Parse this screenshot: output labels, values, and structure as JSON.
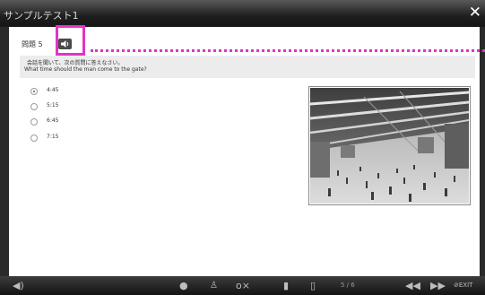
{
  "window": {
    "title": "サンプルテスト1"
  },
  "question": {
    "label": "問題 5",
    "instruction_jp": "会話を聞いて、次の質問に答えなさい。",
    "instruction_en": "What time should the man come to the gate?",
    "options": [
      {
        "text": "4:45",
        "selected": true
      },
      {
        "text": "5:15",
        "selected": false
      },
      {
        "text": "6:45",
        "selected": false
      },
      {
        "text": "7:15",
        "selected": false
      }
    ]
  },
  "footer": {
    "page_indicator": "5 / 6",
    "exit_label": "EXIT"
  },
  "colors": {
    "highlight": "#e233c6",
    "titlebar": "#1e1e1e"
  },
  "icons": [
    "speaker-icon",
    "close-icon",
    "volume-icon",
    "comment-icon",
    "person-icon",
    "key-icon",
    "document-icon",
    "document-list-icon",
    "rewind-icon",
    "fast-forward-icon",
    "exit-icon"
  ]
}
